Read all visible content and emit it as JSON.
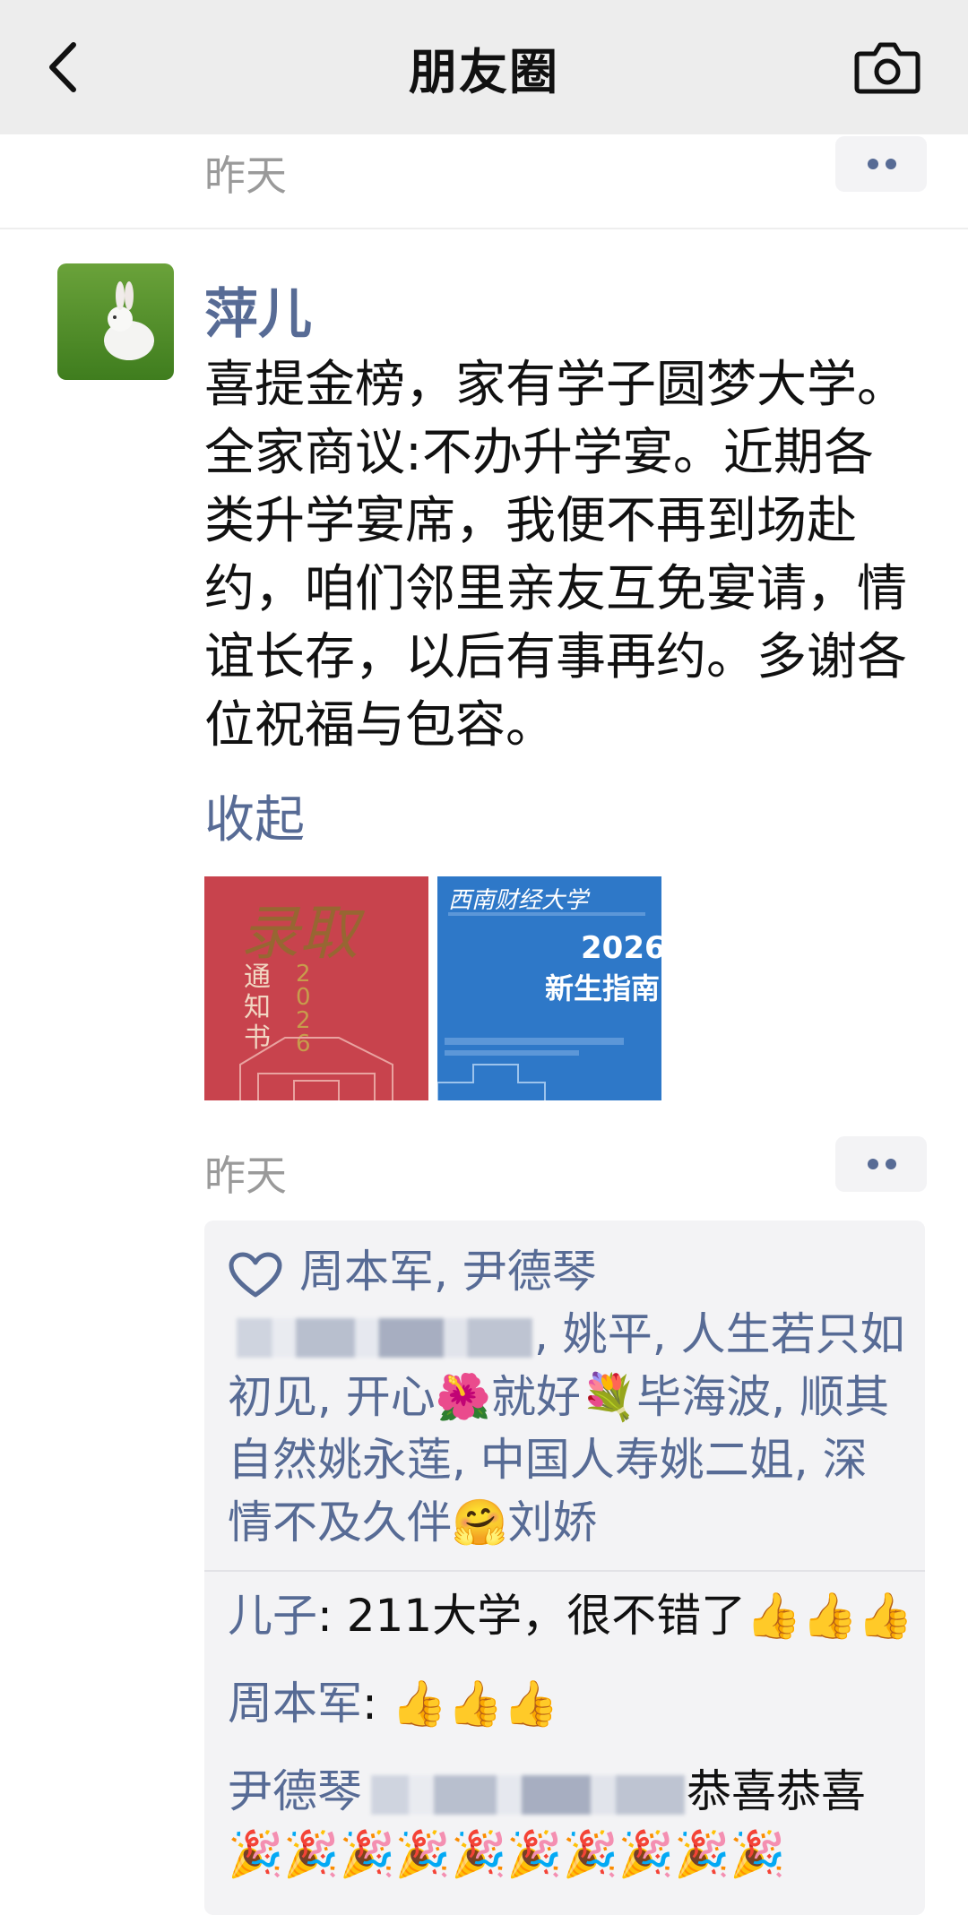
{
  "header": {
    "title": "朋友圈",
    "back_icon": "chevron-left-icon",
    "camera_icon": "camera-icon"
  },
  "prev_post": {
    "time": "昨天"
  },
  "post": {
    "author": "萍儿",
    "text": "喜提金榜，家有学子圆梦大学。全家商议:不办升学宴。近期各类升学宴席，我便不再到场赴约，咱们邻里亲友互免宴请，情谊长存，以后有事再约。多谢各位祝福与包容。",
    "collapse_label": "收起",
    "photos": [
      {
        "alt_text_title": "录取",
        "alt_text_sub": "通知书",
        "alt_year": "2026",
        "color": "#c8434d"
      },
      {
        "school": "西南财经大学",
        "year": "2026",
        "subtitle": "新生指南",
        "color": "#2e78c8"
      }
    ],
    "time": "昨天"
  },
  "likes": {
    "first_line": "周本军, 尹德琴",
    "rest_after_blur": ", 姚平, 人生若只如初见, 开心🌺就好💐毕海波, 顺其自然姚永莲, 中国人寿姚二姐, 深情不及久伴🤗刘娇"
  },
  "comments": [
    {
      "author": "儿子",
      "sep": ": ",
      "text": "211大学，很不错了👍👍👍"
    },
    {
      "author": "周本军",
      "sep": ": ",
      "text": "👍👍👍"
    },
    {
      "author": "尹德琴",
      "sep": "",
      "text": "恭喜恭喜🎉🎉🎉🎉🎉🎉🎉🎉🎉🎉"
    }
  ],
  "colors": {
    "link": "#576b95",
    "topbar": "#ededed",
    "panel": "#f3f3f5"
  }
}
